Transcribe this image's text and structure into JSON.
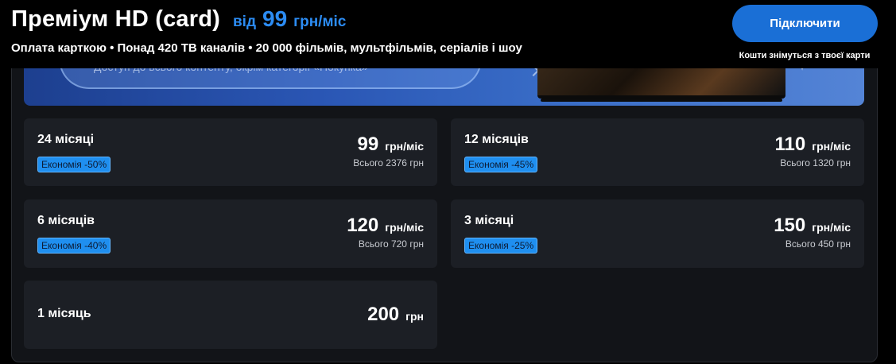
{
  "header": {
    "title": "Преміум HD (card)",
    "price_prefix": "від",
    "price_value": "99",
    "price_unit": "грн/міс",
    "subtitle": "Оплата карткою • Понад 420 ТВ каналів • 20 000 фільмів, мультфільмів, серіалів і шоу",
    "connect_label": "Підключити",
    "connect_note": "Кошти знімуться з твоєї карти"
  },
  "banner": {
    "text": "Доступ до всього контенту, окрім категорії «Покупка»"
  },
  "plans": [
    {
      "period": "24 місяці",
      "badge": "Економія -50%",
      "price": "99",
      "unit": "грн/міс",
      "total": "Всього 2376 грн"
    },
    {
      "period": "12 місяців",
      "badge": "Економія -45%",
      "price": "110",
      "unit": "грн/міс",
      "total": "Всього 1320 грн"
    },
    {
      "period": "6 місяців",
      "badge": "Економія -40%",
      "price": "120",
      "unit": "грн/міс",
      "total": "Всього 720 грн"
    },
    {
      "period": "3 місяці",
      "badge": "Економія -25%",
      "price": "150",
      "unit": "грн/міс",
      "total": "Всього 450 грн"
    },
    {
      "period": "1 місяць",
      "price": "200",
      "unit": "грн"
    }
  ],
  "colors": {
    "accent": "#2c8cf3",
    "button": "#1a6fd6",
    "badge": "#1f8ff0",
    "card": "#1c1f25",
    "panel": "#121418"
  }
}
